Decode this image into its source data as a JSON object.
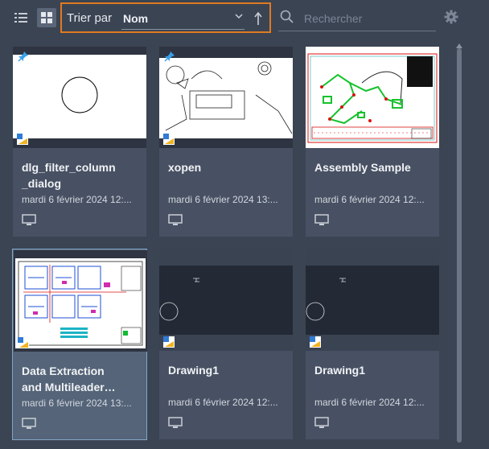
{
  "toolbar": {
    "list_view_icon": "list-icon",
    "grid_view_icon": "grid-icon",
    "sort_label": "Trier par",
    "sort_value": "Nom",
    "sort_direction_icon": "arrow-up-icon",
    "search_placeholder": "Rechercher",
    "settings_icon": "gear-icon",
    "accent_color": "#e07a22"
  },
  "cards": [
    {
      "title": "dlg_filter_column\n_dialog",
      "date": "mardi 6 février 2024 12:...",
      "pinned": true
    },
    {
      "title": "xopen",
      "date": "mardi 6 février 2024 13:...",
      "pinned": true
    },
    {
      "title": "Assembly Sample",
      "date": "mardi 6 février 2024 12:...",
      "pinned": false
    },
    {
      "title": "Data Extraction\nand Multileader…",
      "date": "mardi 6 février 2024 13:...",
      "pinned": false,
      "selected": true
    },
    {
      "title": "Drawing1",
      "date": "mardi 6 février 2024 12:...",
      "pinned": false
    },
    {
      "title": "Drawing1",
      "date": "mardi 6 février 2024 12:...",
      "pinned": false
    }
  ]
}
